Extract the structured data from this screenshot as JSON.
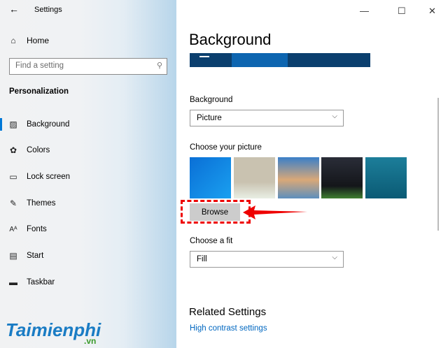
{
  "window": {
    "title": "Settings",
    "minimize": "—",
    "maximize": "☐",
    "close": "✕"
  },
  "sidebar": {
    "home": "Home",
    "search_placeholder": "Find a setting",
    "section": "Personalization",
    "items": [
      {
        "label": "Background",
        "icon": "picture-icon"
      },
      {
        "label": "Colors",
        "icon": "palette-icon"
      },
      {
        "label": "Lock screen",
        "icon": "lock-screen-icon"
      },
      {
        "label": "Themes",
        "icon": "themes-icon"
      },
      {
        "label": "Fonts",
        "icon": "fonts-icon"
      },
      {
        "label": "Start",
        "icon": "start-icon"
      },
      {
        "label": "Taskbar",
        "icon": "taskbar-icon"
      }
    ]
  },
  "main": {
    "heading": "Background",
    "background_label": "Background",
    "background_value": "Picture",
    "choose_picture": "Choose your picture",
    "browse": "Browse",
    "choose_fit": "Choose a fit",
    "fit_value": "Fill",
    "related": "Related Settings",
    "related_link": "High contrast settings"
  },
  "watermark": {
    "brand": "Taimienphi",
    ".vn": ".vn"
  },
  "colors": {
    "accent": "#0078d7",
    "link": "#0067c0",
    "annotation": "#e00000"
  }
}
